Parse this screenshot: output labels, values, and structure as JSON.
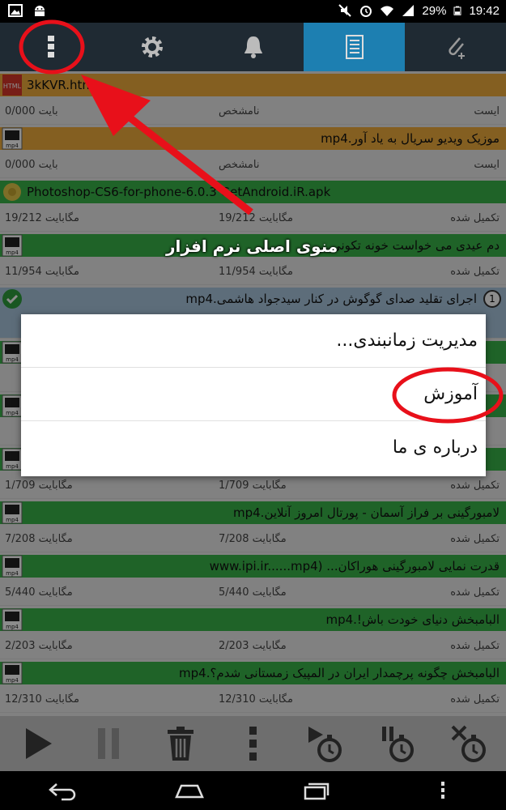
{
  "status_bar": {
    "battery": "29%",
    "time": "19:42"
  },
  "toolbar": {
    "items": [
      {
        "icon": "overflow-menu-icon"
      },
      {
        "icon": "gear-icon"
      },
      {
        "icon": "bell-icon"
      },
      {
        "icon": "document-list-icon",
        "active": true
      },
      {
        "icon": "paperclip-add-icon"
      }
    ]
  },
  "downloads": [
    {
      "name": "3kKVR.htm",
      "icon": "html-file-icon",
      "bar": "orange",
      "size": "0/000 بایت",
      "done": "نامشخص",
      "status": "ایست"
    },
    {
      "name": "موزیک ویدیو سریال به یاد آور.mp4",
      "icon": "mp4-file-icon",
      "bar": "orange",
      "size": "0/000 بایت",
      "done": "نامشخص",
      "status": "ایست"
    },
    {
      "name": "Photoshop-CS6-for-phone-6.0.3 GetAndroid.iR.apk",
      "icon": "apk-file-icon",
      "bar": "green",
      "size": "19/212 مگابایت",
      "done": "19/212 مگابایت",
      "status": "تکمیل شده"
    },
    {
      "name": "دم عیدی می خواست خونه تکونی",
      "icon": "mp4-file-icon",
      "bar": "green",
      "size": "11/954 مگابایت",
      "done": "11/954 مگابایت",
      "status": "تکمیل شده"
    },
    {
      "name": "اجرای تقلید صدای گوگوش در کنار سیدجواد هاشمی.mp4",
      "icon": "check-icon",
      "bar": "blue",
      "size": "",
      "done": "",
      "status": "",
      "badge": "1"
    },
    {
      "name": "",
      "icon": "mp4-file-icon",
      "bar": "green",
      "size": "",
      "done": "",
      "status": ""
    },
    {
      "name": "",
      "icon": "mp4-file-icon",
      "bar": "green",
      "size": "",
      "done": "",
      "status": ""
    },
    {
      "name": "",
      "icon": "mp4-file-icon",
      "bar": "green",
      "size": "1/709 مگابایت",
      "done": "1/709 مگابایت",
      "status": "تکمیل شده"
    },
    {
      "name": "لامبورگینی بر فراز آسمان - پورتال امروز آنلاین.mp4",
      "icon": "mp4-file-icon",
      "bar": "green",
      "size": "7/208 مگابایت",
      "done": "7/208 مگابایت",
      "status": "تکمیل شده"
    },
    {
      "name": "قدرت نمایی لامبورگینی هوراکان... (www.ipi.ir......mp4",
      "icon": "mp4-file-icon",
      "bar": "green",
      "size": "5/440 مگابایت",
      "done": "5/440 مگابایت",
      "status": "تکمیل شده"
    },
    {
      "name": "البامبخش دنیای خودت باش!.mp4",
      "icon": "mp4-file-icon",
      "bar": "green",
      "size": "2/203 مگابایت",
      "done": "2/203 مگابایت",
      "status": "تکمیل شده"
    },
    {
      "name": "البامبخش چگونه پرچمدار ایران در المپیک زمستانی شدم؟.mp4",
      "icon": "mp4-file-icon",
      "bar": "green",
      "size": "12/310 مگابایت",
      "done": "12/310 مگابایت",
      "status": "تکمیل شده"
    }
  ],
  "dialog": {
    "items": [
      "مدیریت زمانبندی...",
      "آموزش",
      "درباره ی ما"
    ]
  },
  "annotation": {
    "label": "منوی اصلی نرم افزار",
    "color": "#e8101a"
  },
  "action_bar": {
    "items": [
      "play-icon",
      "pause-icon",
      "trash-icon",
      "overflow-menu-icon",
      "timer-play-icon",
      "timer-pause-icon",
      "timer-cancel-icon"
    ]
  },
  "nav_bar": {
    "items": [
      "back-icon",
      "home-icon",
      "recents-icon",
      "menu-icon"
    ]
  }
}
